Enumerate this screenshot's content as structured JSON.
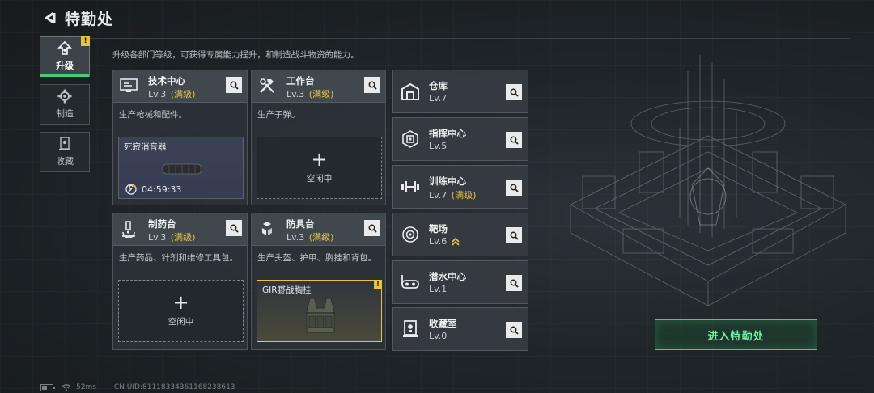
{
  "header": {
    "title": "特勤处"
  },
  "nav": [
    {
      "label": "升级",
      "icon": "upgrade-icon",
      "active": true,
      "badge": "!"
    },
    {
      "label": "制造",
      "icon": "gear-icon",
      "active": false
    },
    {
      "label": "收藏",
      "icon": "collection-icon",
      "active": false
    }
  ],
  "description": "升级各部门等级，可获得专属能力提升，和制造战斗物资的能力。",
  "cards": [
    {
      "name": "技术中心",
      "level": "Lv.3",
      "max": "(满级)",
      "subtitle": "生产枪械和配件。",
      "slot": {
        "type": "producing",
        "item": "死寂消音器",
        "timer": "04:59:33"
      }
    },
    {
      "name": "工作台",
      "level": "Lv.3",
      "max": "(满级)",
      "subtitle": "生产子弹。",
      "slot": {
        "type": "idle",
        "plus": "+",
        "label": "空闲中"
      }
    },
    {
      "name": "制药台",
      "level": "Lv.3",
      "max": "(满级)",
      "subtitle": "生产药品、针剂和维修工具包。",
      "slot": {
        "type": "idle",
        "plus": "+",
        "label": "空闲中"
      }
    },
    {
      "name": "防具台",
      "level": "Lv.3",
      "max": "(满级)",
      "subtitle": "生产头盔、护甲、胸挂和背包。",
      "slot": {
        "type": "done",
        "item": "GIR野战胸挂",
        "badge": "!"
      }
    }
  ],
  "facilities": [
    {
      "name": "仓库",
      "level": "Lv.7",
      "max": "",
      "icon": "warehouse-icon"
    },
    {
      "name": "指挥中心",
      "level": "Lv.5",
      "max": "",
      "icon": "chip-icon"
    },
    {
      "name": "训练中心",
      "level": "Lv.7",
      "max": "(满级)",
      "icon": "dumbbell-icon"
    },
    {
      "name": "靶场",
      "level": "Lv.6",
      "max": "",
      "icon": "target-icon",
      "upgrade": true
    },
    {
      "name": "潜水中心",
      "level": "Lv.1",
      "max": "",
      "icon": "diving-mask-icon"
    },
    {
      "name": "收藏室",
      "level": "Lv.0",
      "max": "",
      "icon": "display-case-icon"
    }
  ],
  "enter_button": "进入特勤处",
  "status": {
    "ping": "52ms",
    "uid": "CN UID:8111833436116823​8613"
  },
  "colors": {
    "accent": "#3fd07b",
    "max_level": "#e9c24a",
    "badge": "#e7c43c"
  }
}
